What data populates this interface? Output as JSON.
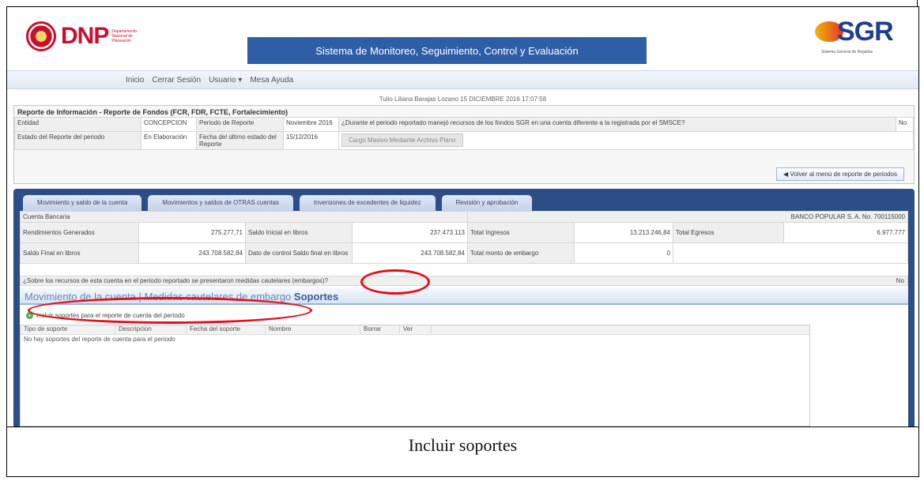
{
  "header": {
    "dnp_name": "DNP",
    "dnp_sub": "Departamento Nacional de Planeación",
    "system_title": "Sistema de Monitoreo, Seguimiento, Control y Evaluación",
    "sgr_name": "SGR",
    "sgr_sub": "Sistema General de Regalías"
  },
  "nav": [
    "Inicio",
    "Cerrar Sesión",
    "Usuario ▾",
    "Mesa Ayuda"
  ],
  "user_line": "Tulio Liliana Barajas Lozano 15 DICIEMBRE 2016 17:07:58",
  "report": {
    "title": "Reporte de Información - Reporte de Fondos (FCR, FDR, FCTE, Fortalecimiento)",
    "entidad_label": "Entidad",
    "entidad_value": "CONCEPCION",
    "periodo_label": "Periodo de Reporte",
    "periodo_value": "Noviembre 2016",
    "question_top": "¿Durante el periodo reportado manejó recursos de los fondos SGR en una cuenta diferente a la registrada por el SMSCE?",
    "question_top_answer": "No",
    "estado_label": "Estado del Reporte del periodo",
    "estado_value": "En Elaboración",
    "fecha_label": "Fecha del último estado del Reporte",
    "fecha_value": "15/12/2016",
    "cargo_button": "Cargo Masivo Mediante Archivo Plano",
    "back_button": "Volver al menú de reporte de periodos"
  },
  "tabs": [
    "Movimiento y saldo de la cuenta",
    "Movimientos y saldos de OTRAS cuentas",
    "Inversiones de excedentes de liquidez",
    "Revisión y aprobación"
  ],
  "account": {
    "cuenta_label": "Cuenta Bancaria",
    "banco": "BANCO POPULAR S. A. No. 700115000",
    "rendimientos_label": "Rendimientos Generados",
    "rendimientos_value": "275.277,71",
    "saldo_inicial_label": "Saldo Inicial en libros",
    "saldo_inicial_value": "237.473.113",
    "total_ingresos_label": "Total Ingresos",
    "total_ingresos_value": "13.213.246,84",
    "total_egresos_label": "Total Egresos",
    "total_egresos_value": "6.977.777",
    "saldo_final_label": "Saldo Final en libros",
    "saldo_final_value": "243.708.582,84",
    "dato_control_label": "Dato de control Saldo final en libros",
    "dato_control_value": "243.708.582,84",
    "embargo_label": "Total monto de embargo",
    "embargo_value": "0",
    "question": "¿Sobre los recursos de esta cuenta en el periodo reportado se presentaron medidas cautelares (embargos)?",
    "question_answer": "No"
  },
  "subtabs": {
    "movimiento": "Movimiento de la cuenta",
    "medidas": "Medidas cautelares de embargo",
    "soportes": "Soportes",
    "sep": "|"
  },
  "incluir_link": "Incluir soportes para el reporte de cuenta del periodo",
  "grid": {
    "columns": [
      "Tipo de soporte",
      "Descripcion",
      "Fecha del soporte",
      "Nombre",
      "Borrar",
      "Ver"
    ],
    "empty": "No hay soportes del reporte de cuenta para el periodo"
  },
  "caption": "Incluir soportes"
}
